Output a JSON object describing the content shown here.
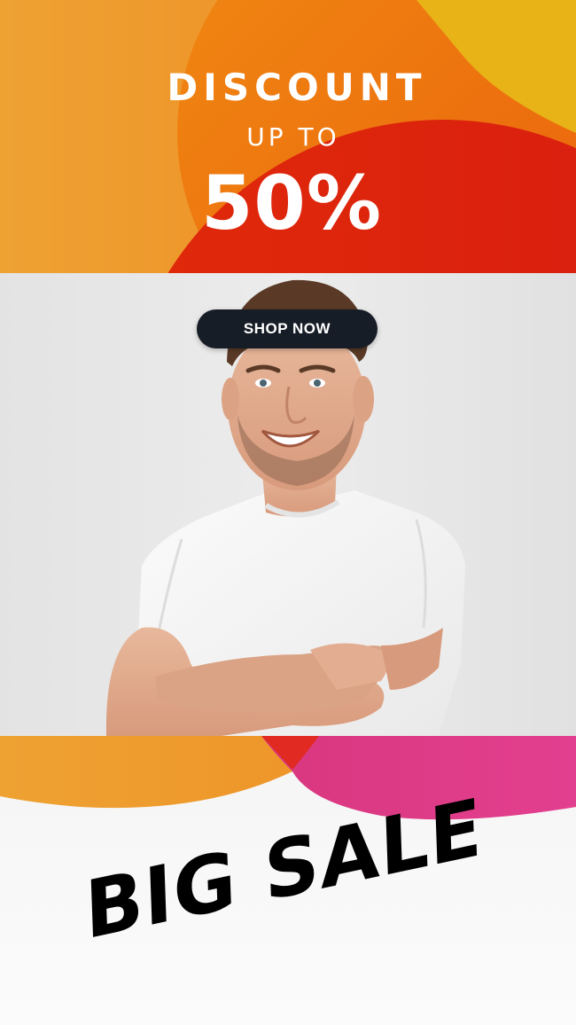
{
  "banner": {
    "discount_label": "DISCOUNT",
    "upto_label": "UP TO",
    "percent_label": "50%"
  },
  "cta": {
    "shop_now_label": "SHOP NOW"
  },
  "footer": {
    "big_sale_label": "BIG SALE"
  },
  "colors": {
    "orange": "#ef8a1f",
    "deep_orange": "#ee6a12",
    "yellow": "#e8b316",
    "red": "#dc1e0c",
    "pink": "#e03c8e",
    "button_dark": "#171d26",
    "photo_background": "#e6e6e6"
  },
  "images": {
    "photo_subject": "smiling man in white t-shirt with crossed arms"
  }
}
